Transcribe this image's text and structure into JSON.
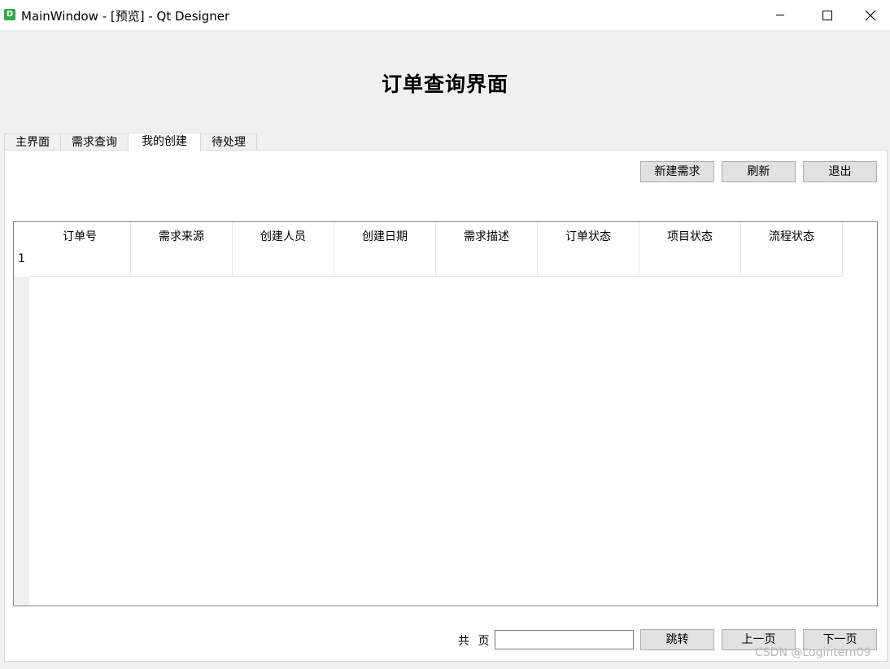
{
  "window": {
    "icon_letter": "D",
    "title": "MainWindow - [预览] - Qt Designer"
  },
  "page_title": "订单查询界面",
  "tabs": [
    {
      "label": "主界面"
    },
    {
      "label": "需求查询"
    },
    {
      "label": "我的创建",
      "active": true
    },
    {
      "label": "待处理"
    }
  ],
  "toolbar": {
    "new_label": "新建需求",
    "refresh_label": "刷新",
    "exit_label": "退出"
  },
  "table": {
    "columns": [
      "订单号",
      "需求来源",
      "创建人员",
      "创建日期",
      "需求描述",
      "订单状态",
      "项目状态",
      "流程状态"
    ],
    "row_numbers": [
      "1"
    ]
  },
  "pager": {
    "total_label": "共 页",
    "page_input_value": "",
    "jump_label": "跳转",
    "prev_label": "上一页",
    "next_label": "下一页"
  },
  "watermark": "CSDN @Logintern09"
}
